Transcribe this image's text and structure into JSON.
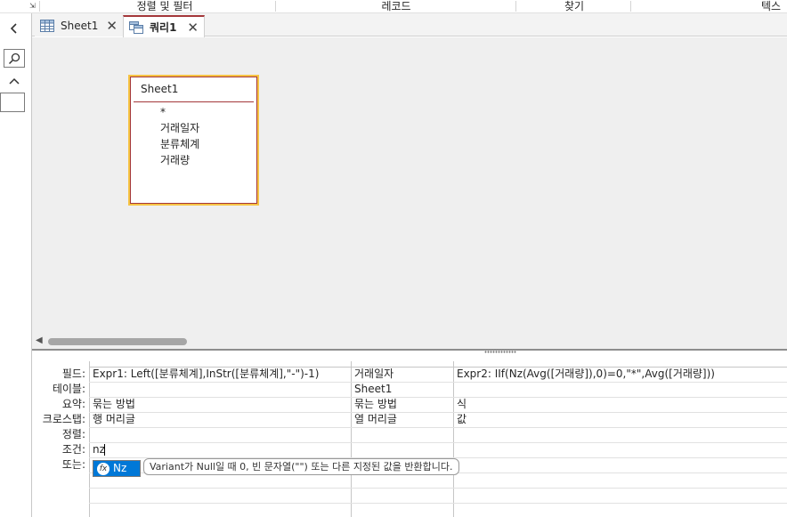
{
  "ribbon": {
    "groups": [
      {
        "label": "정렬 및 필터"
      },
      {
        "label": "레코드"
      },
      {
        "label": "찾기"
      },
      {
        "label": "텍스"
      }
    ]
  },
  "tabs": [
    {
      "label": "Sheet1",
      "active": false
    },
    {
      "label": "쿼리1",
      "active": true
    }
  ],
  "table_box": {
    "title": "Sheet1",
    "fields": [
      "*",
      "거래일자",
      "분류체계",
      "거래량"
    ]
  },
  "grid": {
    "row_labels": [
      "필드:",
      "테이블:",
      "요약:",
      "크로스탭:",
      "정렬:",
      "조건:",
      "또는:"
    ],
    "columns": [
      {
        "field": "Expr1: Left([분류체계],InStr([분류체계],\"-\")-1)",
        "table": "",
        "total": "묶는 방법",
        "crosstab": "행 머리글",
        "sort": "",
        "criteria": "nz"
      },
      {
        "field": "거래일자",
        "table": "Sheet1",
        "total": "묶는 방법",
        "crosstab": "열 머리글",
        "sort": "",
        "criteria": ""
      },
      {
        "field": "Expr2: IIf(Nz(Avg([거래량]),0)=0,\"*\",Avg([거래량]))",
        "table": "",
        "total": "식",
        "crosstab": "값",
        "sort": "",
        "criteria": ""
      }
    ]
  },
  "autocomplete": {
    "item": "Nz",
    "tooltip": "Variant가 Null일 때 0, 빈 문자열(\"\") 또는 다른 지정된 값을 반환합니다."
  },
  "colors": {
    "accent": "#a4373a",
    "table_selected_border": "#f6c343",
    "selection": "#0078d7",
    "pane_bg": "#efefef"
  }
}
